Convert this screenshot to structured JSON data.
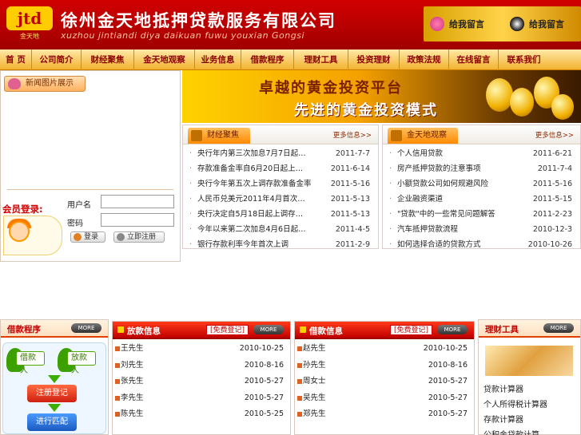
{
  "header": {
    "logo_text": "jtd",
    "logo_sub": "金天地",
    "company_name": "徐州金天地抵押贷款服务有限公司",
    "company_pinyin": "xuzhou jintiandi diya daikuan fuwu youxian Gongsi",
    "message_buttons": [
      "给我留言",
      "给我留言"
    ]
  },
  "nav": {
    "items": [
      "首 页",
      "公司简介",
      "财经聚焦",
      "金天地观察",
      "业务信息",
      "借款程序",
      "理财工具",
      "投资理财",
      "政策法规",
      "在线留言",
      "联系我们"
    ]
  },
  "news_pic": {
    "title": "新闻图片展示"
  },
  "login": {
    "label": "会员登录:",
    "username_label": "用户名",
    "password_label": "密码",
    "login_button": "登录",
    "register_button": "立即注册"
  },
  "banner": {
    "line1": "卓越的黄金投资平台",
    "line2": "先进的黄金投资模式"
  },
  "finance_news": {
    "title": "财经聚焦",
    "more": "更多信息>>",
    "items": [
      {
        "title": "央行年内第三次加息7月7日起…",
        "date": "2011-7-7"
      },
      {
        "title": "存款准备金率自6月20日起上…",
        "date": "2011-6-14"
      },
      {
        "title": "央行今年第五次上调存款准备金率",
        "date": "2011-5-16"
      },
      {
        "title": "人民币兑美元2011年4月首次…",
        "date": "2011-5-13"
      },
      {
        "title": "央行决定自5月18日起上调存…",
        "date": "2011-5-13"
      },
      {
        "title": "今年以来第二次加息4月6日起…",
        "date": "2011-4-5"
      },
      {
        "title": "银行存款利率今年首次上调",
        "date": "2011-2-9"
      }
    ]
  },
  "jtd_watch": {
    "title": "金天地观察",
    "more": "更多信息>>",
    "items": [
      {
        "title": "个人信用贷款",
        "date": "2011-6-21"
      },
      {
        "title": "房产抵押贷款的注意事项",
        "date": "2011-7-4"
      },
      {
        "title": "小额贷款公司如何规避风险",
        "date": "2011-5-16"
      },
      {
        "title": "企业融资渠道",
        "date": "2011-5-15"
      },
      {
        "title": "\"贷款\"中的一些常见问题解答",
        "date": "2011-2-23"
      },
      {
        "title": "汽车抵押贷款流程",
        "date": "2010-12-3"
      },
      {
        "title": "如何选择合适的贷款方式",
        "date": "2010-10-26"
      }
    ]
  },
  "loan_process": {
    "title": "借款程序",
    "more": "MORE",
    "borrower": "借款人",
    "lender": "放款人",
    "steps": [
      "注册登记",
      "进行匹配"
    ]
  },
  "lending_info": {
    "title": "放款信息",
    "free_register": "[免费登记]",
    "more": "MORE",
    "items": [
      {
        "title": "王先生",
        "date": "2010-10-25"
      },
      {
        "title": "刘先生",
        "date": "2010-8-16"
      },
      {
        "title": "张先生",
        "date": "2010-5-27"
      },
      {
        "title": "李先生",
        "date": "2010-5-27"
      },
      {
        "title": "陈先生",
        "date": "2010-5-25"
      }
    ]
  },
  "borrow_info": {
    "title": "借款信息",
    "free_register": "[免费登记]",
    "more": "MORE",
    "items": [
      {
        "title": "赵先生",
        "date": "2010-10-25"
      },
      {
        "title": "孙先生",
        "date": "2010-8-16"
      },
      {
        "title": "周女士",
        "date": "2010-5-27"
      },
      {
        "title": "吴先生",
        "date": "2010-5-27"
      },
      {
        "title": "郑先生",
        "date": "2010-5-27"
      }
    ]
  },
  "finance_tools": {
    "title": "理财工具",
    "more": "MORE",
    "items": [
      "贷款计算器",
      "个人所得税计算器",
      "存款计算器",
      "公积金贷款计算"
    ]
  },
  "colors": {
    "header_red": "#c00000",
    "nav_gold": "#f2b230",
    "accent_orange": "#ff8a00",
    "process_red": "#e03020",
    "process_blue": "#2a7ad8",
    "process_green": "#3cae00"
  }
}
